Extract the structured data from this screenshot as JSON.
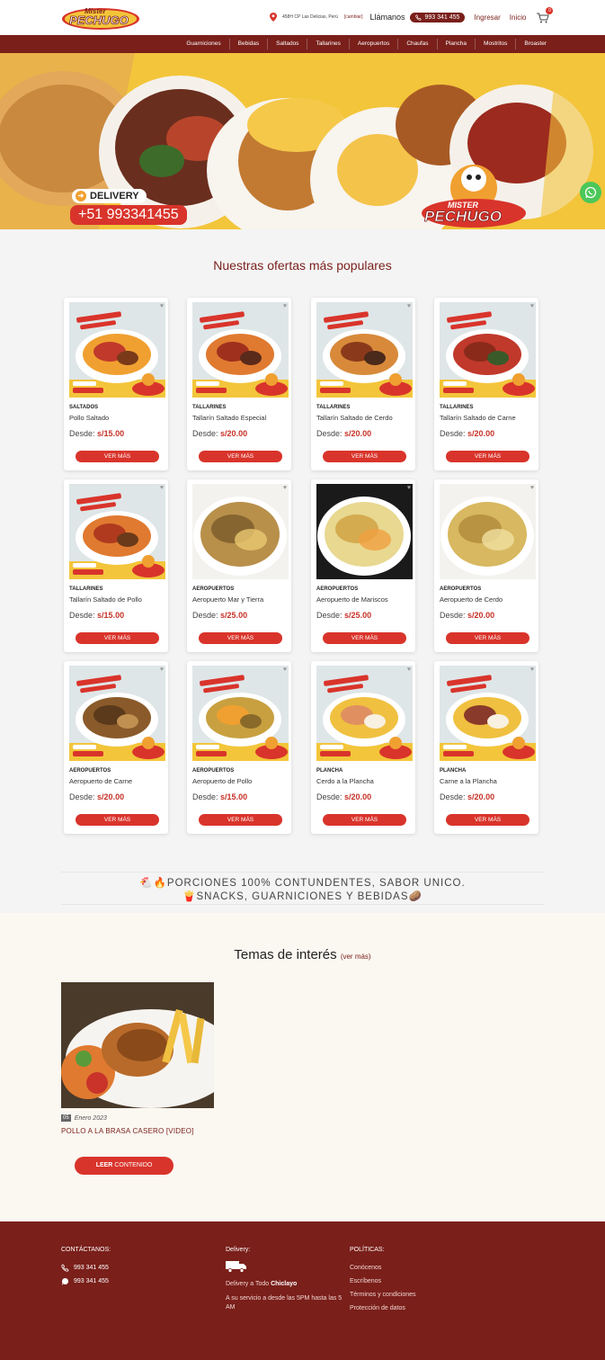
{
  "header": {
    "logo_line1": "Mister",
    "logo_line2": "PECHUGO",
    "address": "458H CP Las Delicias, Perú",
    "change_label": "[cambiar]",
    "call_label": "Llámanos",
    "phone": "993 341 455",
    "login_label": "Ingresar",
    "home_label": "Inicio",
    "cart_count": "0"
  },
  "nav": {
    "items": [
      "Guarniciones",
      "Bebidas",
      "Saltados",
      "Tallarines",
      "Aeropuertos",
      "Chaufas",
      "Plancha",
      "Mostritos",
      "Broaster"
    ]
  },
  "hero": {
    "delivery_label": "DELIVERY",
    "delivery_phone": "+51 993341455",
    "logo_line1": "MISTER",
    "logo_line2": "PECHUGO"
  },
  "offers": {
    "title": "Nuestras ofertas más populares",
    "price_prefix": "Desde:",
    "button_label": "VER MÁS",
    "products": [
      {
        "category": "SALTADOS",
        "name": "Pollo Saltado",
        "price": "s/15.00"
      },
      {
        "category": "TALLARINES",
        "name": "Tallarín Saltado Especial",
        "price": "s/20.00"
      },
      {
        "category": "TALLARINES",
        "name": "Tallarín Saltado de Cerdo",
        "price": "s/20.00"
      },
      {
        "category": "TALLARINES",
        "name": "Tallarín Saltado de Carne",
        "price": "s/20.00"
      },
      {
        "category": "TALLARINES",
        "name": "Tallarín Saltado de Pollo",
        "price": "s/15.00"
      },
      {
        "category": "AEROPUERTOS",
        "name": "Aeropuerto Mar y Tierra",
        "price": "s/25.00"
      },
      {
        "category": "AEROPUERTOS",
        "name": "Aeropuerto de Mariscos",
        "price": "s/25.00"
      },
      {
        "category": "AEROPUERTOS",
        "name": "Aeropuerto de Cerdo",
        "price": "s/20.00"
      },
      {
        "category": "AEROPUERTOS",
        "name": "Aeropuerto de Carne",
        "price": "s/20.00"
      },
      {
        "category": "AEROPUERTOS",
        "name": "Aeropuerto de Pollo",
        "price": "s/15.00"
      },
      {
        "category": "PLANCHA",
        "name": "Cerdo a la Plancha",
        "price": "s/20.00"
      },
      {
        "category": "PLANCHA",
        "name": "Carne a la Plancha",
        "price": "s/20.00"
      }
    ]
  },
  "promo": {
    "line1": "🐔🔥PORCIONES 100% CONTUNDENTES, SABOR UNICO.",
    "line2": "🍟SNACKS, GUARNICIONES Y BEBIDAS🥔"
  },
  "blog": {
    "title": "Temas de interés",
    "see_more": "(ver más)",
    "post_day": "05",
    "post_month": "Enero 2023",
    "post_title": "POLLO A LA BRASA CASERO [VIDEO]",
    "read_bold": "LEER",
    "read_rest": "CONTENIDO"
  },
  "footer": {
    "contact_title": "CONTÁCTANOS:",
    "phone1": "993 341 455",
    "phone2": "993 341 455",
    "delivery_title": "Delivery:",
    "delivery_text": "Delivery a Todo",
    "delivery_city": "Chiclayo",
    "service_text": "A su servicio a desde las 5PM hasta las 5 AM",
    "policies_title": "POLÍTICAS:",
    "policies": [
      "Conócenos",
      "Escríbenos",
      "Términos y condiciones",
      "Protección de datos"
    ]
  },
  "colors": {
    "brand": "#7a1f1a",
    "accent": "#d9342b",
    "hero_yellow": "#f3c53a",
    "whatsapp": "#4bc75a"
  }
}
